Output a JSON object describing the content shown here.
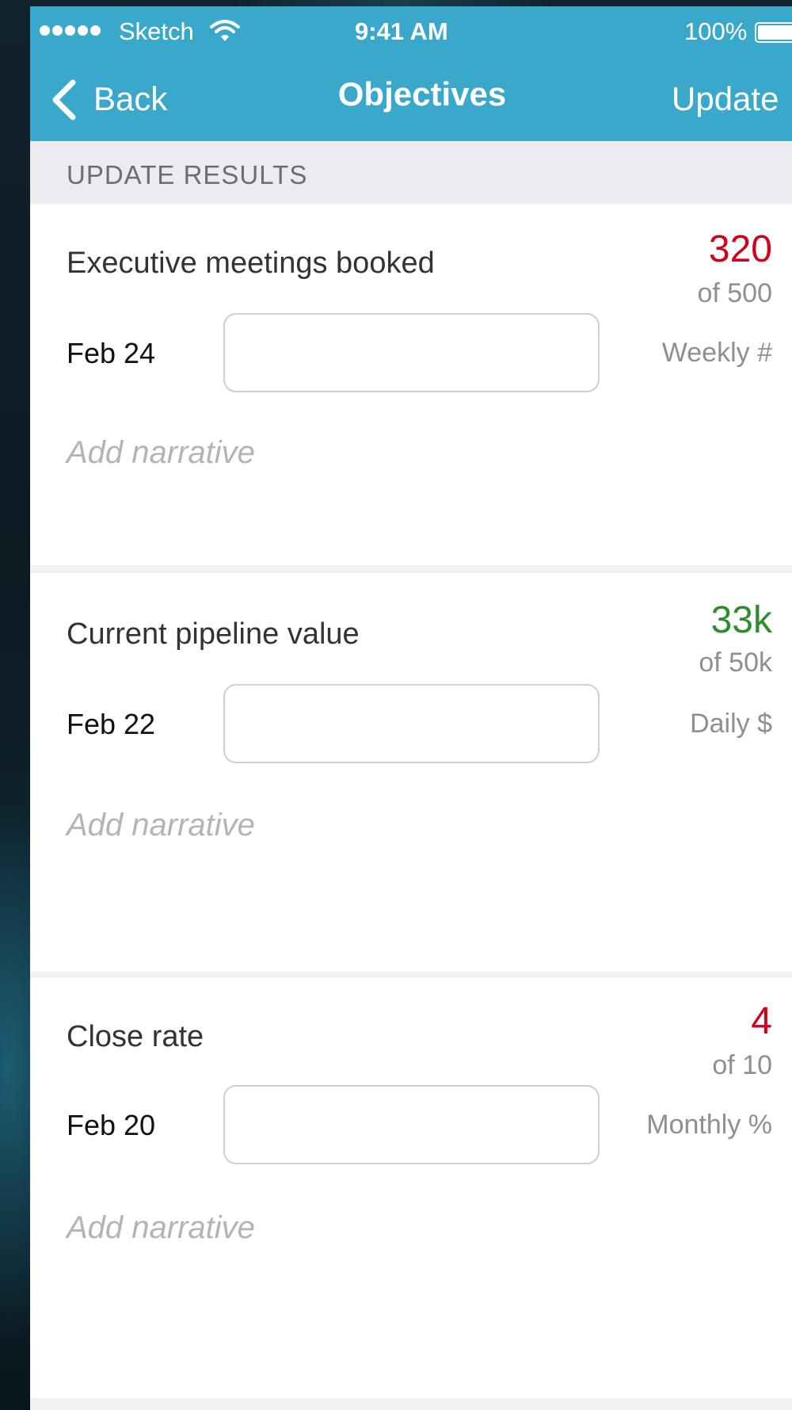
{
  "status_bar": {
    "carrier": "Sketch",
    "time": "9:41 AM",
    "battery": "100%"
  },
  "nav": {
    "back_label": "Back",
    "title": "Objectives",
    "update_label": "Update"
  },
  "section": {
    "title": "UPDATE RESULTS"
  },
  "colors": {
    "header_bg": "#3aa8cb",
    "value_below_target": "#d0021b",
    "value_on_track": "#2e8b2e"
  },
  "icons": [
    "signal-icon",
    "wifi-icon",
    "battery-icon",
    "back-chevron-icon"
  ],
  "objectives": [
    {
      "title": "Executive meetings booked",
      "value": "320",
      "target": "of 500",
      "date": "Feb 24",
      "input_value": "",
      "frequency": "Weekly #",
      "narrative_placeholder": "Add narrative",
      "value_color": "#d0021b"
    },
    {
      "title": "Current pipeline value",
      "value": "33k",
      "target": "of 50k",
      "date": "Feb 22",
      "input_value": "",
      "frequency": "Daily $",
      "narrative_placeholder": "Add narrative",
      "value_color": "#2e8b2e"
    },
    {
      "title": "Close rate",
      "value": "4",
      "target": "of 10",
      "date": "Feb 20",
      "input_value": "",
      "frequency": "Monthly %",
      "narrative_placeholder": "Add narrative",
      "value_color": "#d0021b"
    }
  ]
}
